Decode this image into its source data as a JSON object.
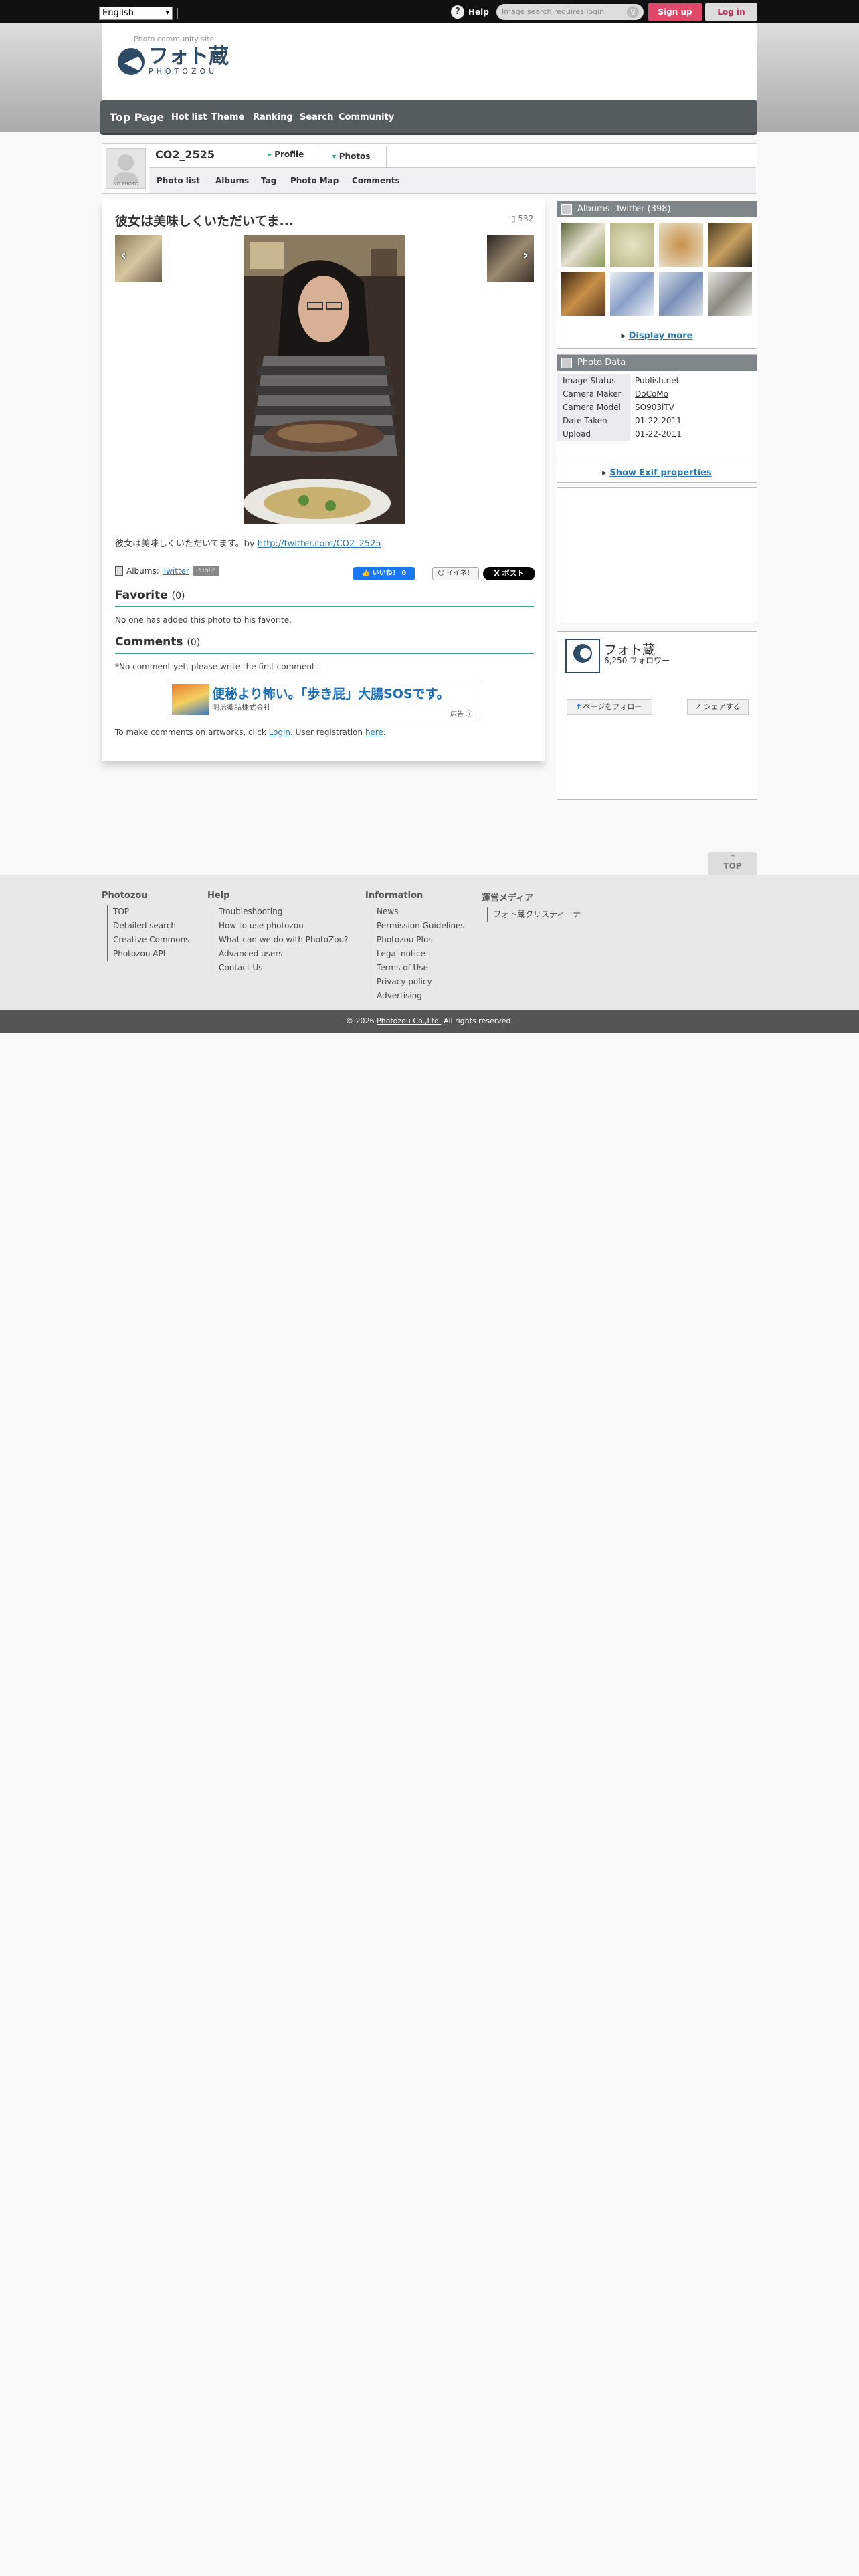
{
  "topbar": {
    "language": "English",
    "help": "Help",
    "search_placeholder": "Image search requires login",
    "signup": "Sign up",
    "login": "Log in"
  },
  "header": {
    "tagline": "Photo community site",
    "logo_jp": "フォト蔵",
    "logo_en": "PHOTOZOU"
  },
  "nav": [
    "Top Page",
    "Hot list",
    "Theme",
    "Ranking",
    "Search",
    "Community"
  ],
  "user": {
    "avatar_text": "NO PHOTO",
    "name": "CO2_2525",
    "tab_profile": "Profile",
    "tab_photos": "Photos",
    "subtabs": [
      "Photo list",
      "Albums",
      "Tag",
      "Photo Map",
      "Comments"
    ]
  },
  "photo": {
    "title": "彼女は美味しくいただいてま...",
    "views": "532",
    "caption": "彼女は美味しくいただいてます。by",
    "caption_link": "http://twitter.com/CO2_2525",
    "albums_label": "Albums:",
    "album_link": "Twitter",
    "visibility": "Public",
    "like": "いいね！ 0",
    "iine": "イイネ！",
    "post": "X ポスト"
  },
  "favorite": {
    "title": "Favorite",
    "count": "(0)",
    "text": "No one has added this photo to his favorite."
  },
  "comments": {
    "title": "Comments",
    "count": "(0)",
    "text": "*No comment yet, please write the first comment.",
    "login_prefix": "To make comments on artworks, click ",
    "login_link": "Login",
    "login_mid": ". User registration ",
    "here_link": "here",
    "login_suffix": "."
  },
  "ad": {
    "title": "便秘より怖い。「歩き屁」大腸SOSです。",
    "sub": "明治薬品株式会社",
    "label": "広告"
  },
  "albums_box": {
    "title": "Albums: Twitter",
    "count": "(398)",
    "display_more": "Display more"
  },
  "photo_data": {
    "title": "Photo Data",
    "rows": [
      {
        "k": "Image Status",
        "v": "Publish.net"
      },
      {
        "k": "Camera Maker",
        "v": "DoCoMo"
      },
      {
        "k": "Camera Model",
        "v": "SO903iTV"
      },
      {
        "k": "Date Taken",
        "v": "01-22-2011"
      },
      {
        "k": "Upload",
        "v": "01-22-2011"
      }
    ],
    "exif": "Show Exif properties"
  },
  "fb": {
    "name": "フォト蔵",
    "followers": "6,250 フォロワー",
    "follow": "ページをフォロー",
    "share": "シェアする"
  },
  "totop": "TOP",
  "footer": {
    "cols": [
      {
        "h": "Photozou",
        "items": [
          "TOP",
          "Detailed search",
          "Creative Commons",
          "Photozou API"
        ]
      },
      {
        "h": "Help",
        "items": [
          "Troubleshooting",
          "How to use photozou",
          "What can we do with PhotoZou?",
          "Advanced users",
          "Contact Us"
        ]
      },
      {
        "h": "Information",
        "items": [
          "News",
          "Permission Guidelines",
          "Photozou Plus",
          "Legal notice",
          "Terms of Use",
          "Privacy policy",
          "Advertising"
        ]
      },
      {
        "h": "運営メディア",
        "items": [
          "フォト蔵クリスティーナ"
        ]
      }
    ],
    "copyright_prefix": "© 2026 ",
    "copyright_link": "Photozou Co.,Ltd.",
    "copyright_suffix": " All rights reserved."
  }
}
